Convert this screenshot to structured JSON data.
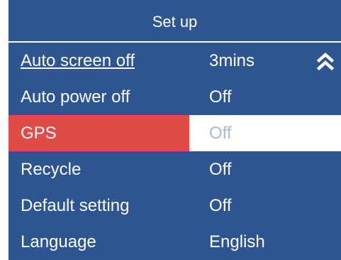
{
  "header": {
    "title": "Set up"
  },
  "menu": {
    "items": [
      {
        "label": "Auto screen off",
        "value": "3mins"
      },
      {
        "label": "Auto power off",
        "value": "Off"
      },
      {
        "label": "GPS",
        "value": "Off"
      },
      {
        "label": "Recycle",
        "value": "Off"
      },
      {
        "label": "Default setting",
        "value": "Off"
      },
      {
        "label": "Language",
        "value": "English"
      }
    ],
    "scroll_icon": "double-chevron-up-icon"
  },
  "colors": {
    "background": "#2c5591",
    "selected_label_bg": "#e04a47",
    "selected_value_bg": "#ffffff",
    "text": "#ffffff"
  }
}
